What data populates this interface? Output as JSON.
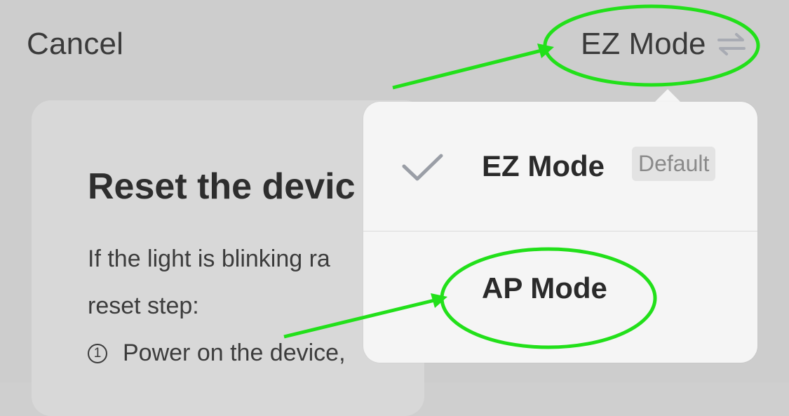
{
  "nav": {
    "cancel_label": "Cancel",
    "mode_label": "EZ Mode"
  },
  "card": {
    "title": "Reset the devic",
    "line1": "If the light is blinking ra",
    "line2": "reset step:",
    "step_number": "1",
    "step_text": "Power on the device,"
  },
  "popover": {
    "items": [
      {
        "label": "EZ Mode",
        "badge": "Default",
        "selected": true
      },
      {
        "label": "AP Mode",
        "selected": false
      }
    ]
  },
  "icons": {
    "swap": "swap-arrows-icon",
    "check": "checkmark-icon"
  },
  "colors": {
    "annotation_green": "#22e01a",
    "check_gray": "#9a9ea6",
    "swap_gray": "#a8abb3"
  }
}
